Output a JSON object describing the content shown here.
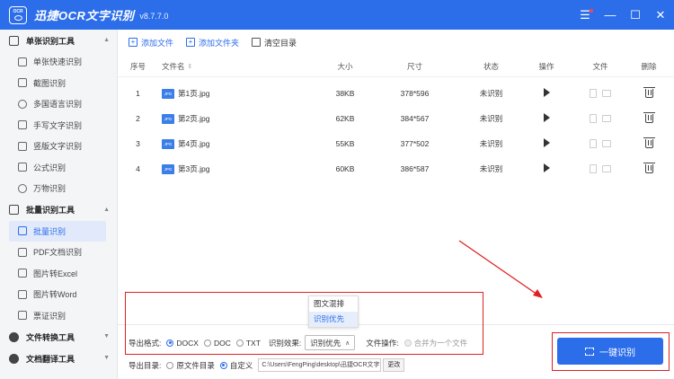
{
  "app": {
    "logo_text": "OCR",
    "title": "迅捷OCR文字识别",
    "version": "v8.7.7.0"
  },
  "window_controls": {
    "menu": "☰",
    "minimize": "—",
    "maximize": "☐",
    "close": "✕"
  },
  "sidebar": {
    "groups": [
      {
        "label": "单张识别工具",
        "items": [
          "单张快速识别",
          "截图识别",
          "多国语言识别",
          "手写文字识别",
          "竖版文字识别",
          "公式识别",
          "万物识别"
        ]
      },
      {
        "label": "批量识别工具",
        "items": [
          "批量识别",
          "PDF文档识别",
          "图片转Excel",
          "图片转Word",
          "票证识别"
        ]
      },
      {
        "label": "文件转换工具",
        "items": []
      },
      {
        "label": "文档翻译工具",
        "items": []
      }
    ]
  },
  "toolbar": {
    "add_file": "添加文件",
    "add_folder": "添加文件夹",
    "clear_list": "清空目录"
  },
  "table": {
    "headers": {
      "no": "序号",
      "name": "文件名",
      "size": "大小",
      "dim": "尺寸",
      "status": "状态",
      "op": "操作",
      "file": "文件",
      "del": "删除"
    },
    "file_icon_text": "JPG",
    "rows": [
      {
        "no": "1",
        "name": "第1页.jpg",
        "size": "38KB",
        "dim": "378*596",
        "status": "未识别"
      },
      {
        "no": "2",
        "name": "第2页.jpg",
        "size": "62KB",
        "dim": "384*567",
        "status": "未识别"
      },
      {
        "no": "3",
        "name": "第4页.jpg",
        "size": "55KB",
        "dim": "377*502",
        "status": "未识别"
      },
      {
        "no": "4",
        "name": "第3页.jpg",
        "size": "60KB",
        "dim": "386*587",
        "status": "未识别"
      }
    ]
  },
  "export": {
    "format_label": "导出格式:",
    "formats": [
      "DOCX",
      "DOC",
      "TXT"
    ],
    "selected_format": "DOCX",
    "effect_label": "识别效果:",
    "effect_value": "识别优先",
    "effect_options": [
      "图文混排",
      "识别优先"
    ],
    "file_op_label": "文件操作:",
    "merge_label": "合并为一个文件",
    "dir_label": "导出目录:",
    "dir_original": "原文件目录",
    "dir_custom": "自定义",
    "dir_path": "C:\\Users\\FengPing\\desktop\\迅捷OCR文字识",
    "change_button": "更改"
  },
  "start_button": "一键识别",
  "colors": {
    "accent": "#2c6dea",
    "highlight": "#e02020"
  }
}
